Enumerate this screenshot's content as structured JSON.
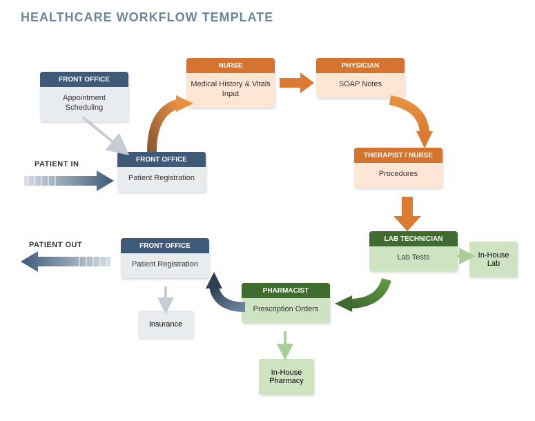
{
  "title": "HEALTHCARE WORKFLOW TEMPLATE",
  "labels": {
    "patient_in": "PATIENT IN",
    "patient_out": "PATIENT OUT"
  },
  "nodes": {
    "fo1": {
      "header": "FRONT OFFICE",
      "body": "Appointment Scheduling"
    },
    "nurse": {
      "header": "NURSE",
      "body": "Medical History & Vitals Input"
    },
    "phys": {
      "header": "PHYSICIAN",
      "body": "SOAP Notes"
    },
    "fo2": {
      "header": "FRONT OFFICE",
      "body": "Patient Registration"
    },
    "ther": {
      "header": "THERAPIST / NURSE",
      "body": "Procedures"
    },
    "fo3": {
      "header": "FRONT OFFICE",
      "body": "Patient Registration"
    },
    "lab": {
      "header": "LAB TECHNICIAN",
      "body": "Lab Tests"
    },
    "pharm": {
      "header": "PHARMACIST",
      "body": "Prescription Orders"
    }
  },
  "subboxes": {
    "insurance": "Insurance",
    "inhouse_pharm": "In-House Pharmacy",
    "inhouse_lab": "In-House Lab"
  }
}
